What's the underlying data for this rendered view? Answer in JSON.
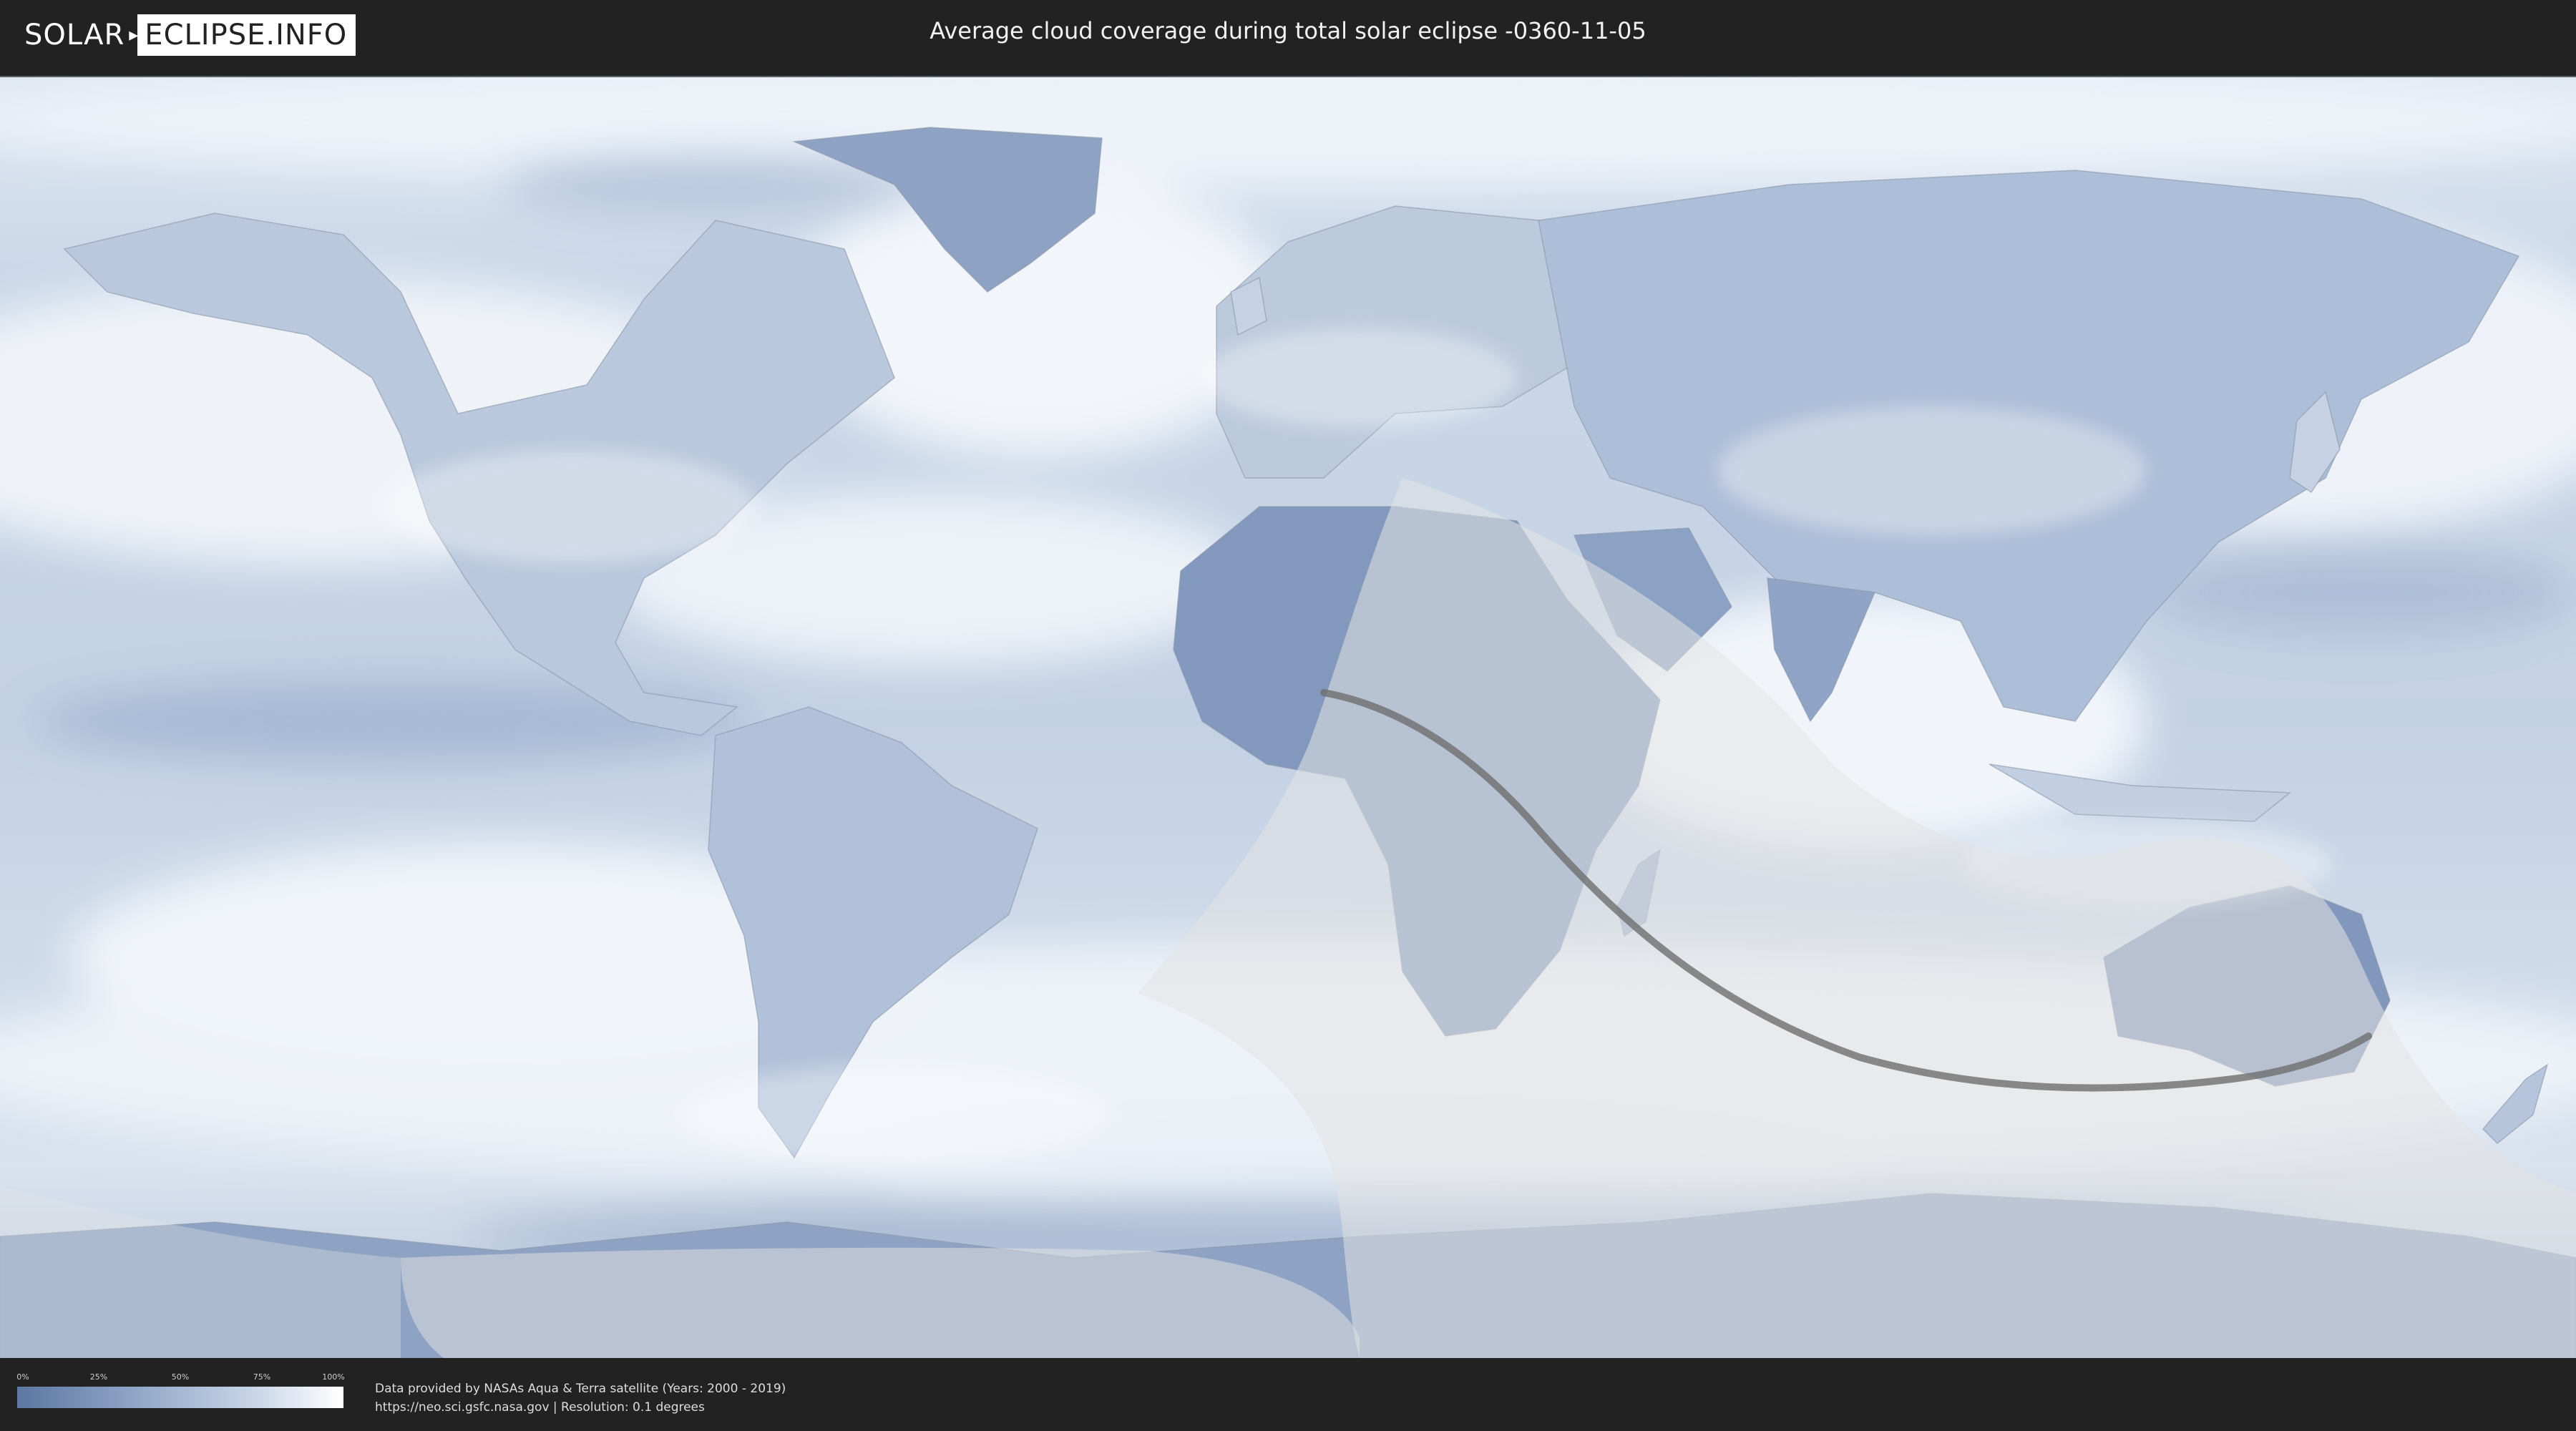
{
  "header": {
    "logo_solar": "SOLAR",
    "logo_eclipse": "ECLIPSE.INFO",
    "title": "Average cloud coverage during total solar eclipse -0360-11-05"
  },
  "legend": {
    "ticks": [
      "0%",
      "25%",
      "50%",
      "75%",
      "100%"
    ],
    "colors": {
      "low": "#5d77a3",
      "high": "#ffffff"
    }
  },
  "footer": {
    "credit_line1": "Data provided by NASAs Aqua & Terra satellite (Years: 2000 - 2019)",
    "credit_line2": "https://neo.sci.gsfc.nasa.gov | Resolution: 0.1 degrees"
  },
  "map": {
    "projection": "equirectangular world map",
    "colors": {
      "ocean_clear": "#c8d5e7",
      "cloud_white": "#f3f6fa",
      "land_clear": "#6f88b2",
      "eclipse_overlay": "#e6e6e6",
      "central_line": "#6e6e6e"
    }
  }
}
